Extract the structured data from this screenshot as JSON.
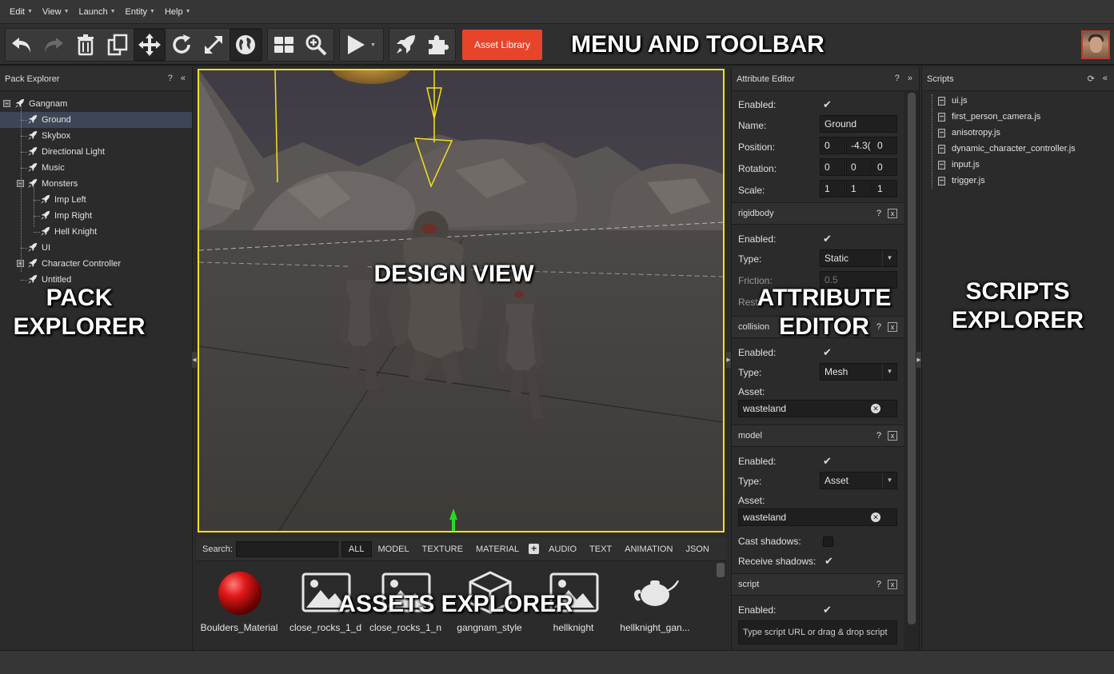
{
  "menu": {
    "items": [
      {
        "label": "Edit"
      },
      {
        "label": "View"
      },
      {
        "label": "Launch"
      },
      {
        "label": "Entity"
      },
      {
        "label": "Help"
      }
    ]
  },
  "toolbar": {
    "asset_library_label": "Asset Library",
    "buttons": [
      "undo-icon",
      "redo-icon",
      "delete-icon",
      "duplicate-icon",
      "translate-icon",
      "rotate-icon",
      "scale-icon",
      "world-space-icon",
      "grid-layout-icon",
      "zoom-icon",
      "play-icon",
      "publish-icon",
      "plugin-icon"
    ]
  },
  "pack_explorer": {
    "title": "Pack Explorer",
    "help": "?",
    "collapse": "«",
    "tree": [
      {
        "label": "Gangnam",
        "depth": 0,
        "expander": "−"
      },
      {
        "label": "Ground",
        "depth": 1,
        "selected": true
      },
      {
        "label": "Skybox",
        "depth": 1
      },
      {
        "label": "Directional Light",
        "depth": 1
      },
      {
        "label": "Music",
        "depth": 1
      },
      {
        "label": "Monsters",
        "depth": 1,
        "expander": "−"
      },
      {
        "label": "Imp Left",
        "depth": 2
      },
      {
        "label": "Imp Right",
        "depth": 2
      },
      {
        "label": "Hell Knight",
        "depth": 2
      },
      {
        "label": "UI",
        "depth": 1
      },
      {
        "label": "Character Controller",
        "depth": 1,
        "expander": "+"
      },
      {
        "label": "Untitled",
        "depth": 1
      }
    ]
  },
  "assets_explorer": {
    "search_label": "Search:",
    "search_value": "",
    "filters": [
      "ALL",
      "MODEL",
      "TEXTURE",
      "MATERIAL",
      "AUDIO",
      "TEXT",
      "ANIMATION",
      "JSON"
    ],
    "active_filter": "ALL",
    "add_icon": "plus-icon",
    "assets": [
      {
        "name": "Boulders_Material",
        "icon": "material-sphere-icon"
      },
      {
        "name": "close_rocks_1_d",
        "icon": "image-icon"
      },
      {
        "name": "close_rocks_1_n",
        "icon": "image-icon"
      },
      {
        "name": "gangnam_style",
        "icon": "model-cube-icon"
      },
      {
        "name": "hellknight",
        "icon": "image-icon"
      },
      {
        "name": "hellknight_gan...",
        "icon": "teapot-icon"
      }
    ]
  },
  "attribute_editor": {
    "title": "Attribute Editor",
    "help": "?",
    "expand": "»",
    "entity": {
      "enabled_label": "Enabled:",
      "enabled": true,
      "name_label": "Name:",
      "name": "Ground",
      "position_label": "Position:",
      "position": [
        "0",
        "-4.3(",
        "0"
      ],
      "rotation_label": "Rotation:",
      "rotation": [
        "0",
        "0",
        "0"
      ],
      "scale_label": "Scale:",
      "scale": [
        "1",
        "1",
        "1"
      ]
    },
    "rigidbody": {
      "title": "rigidbody",
      "enabled_label": "Enabled:",
      "enabled": true,
      "type_label": "Type:",
      "type": "Static",
      "friction_label": "Friction:",
      "friction": "0.5",
      "restitution_label": "Resti"
    },
    "collision": {
      "title": "collision",
      "enabled_label": "Enabled:",
      "enabled": true,
      "type_label": "Type:",
      "type": "Mesh",
      "asset_label": "Asset:",
      "asset": "wasteland"
    },
    "model": {
      "title": "model",
      "enabled_label": "Enabled:",
      "enabled": true,
      "type_label": "Type:",
      "type": "Asset",
      "asset_label": "Asset:",
      "asset": "wasteland",
      "cast_shadows_label": "Cast shadows:",
      "cast_shadows": false,
      "receive_shadows_label": "Receive shadows:",
      "receive_shadows": true
    },
    "script": {
      "title": "script",
      "enabled_label": "Enabled:",
      "enabled": true,
      "url_placeholder": "Type script URL or drag & drop script"
    },
    "component_help": "?",
    "component_close": "x"
  },
  "scripts_explorer": {
    "title": "Scripts",
    "collapse": "«",
    "refresh_icon": "refresh-icon",
    "files": [
      "ui.js",
      "first_person_camera.js",
      "anisotropy.js",
      "dynamic_character_controller.js",
      "input.js",
      "trigger.js"
    ]
  },
  "overlays": {
    "menu_toolbar": "MENU AND TOOLBAR",
    "pack_explorer": "PACK\nEXPLORER",
    "design_view": "DESIGN VIEW",
    "attribute_editor": "ATTRIBUTE\nEDITOR",
    "scripts_explorer": "SCRIPTS\nEXPLORER",
    "assets_explorer": "ASSETS EXPLORER"
  },
  "colors": {
    "accent": "#e8442a",
    "viewport_border": "#f5e11b",
    "selection": "#3d4656"
  }
}
